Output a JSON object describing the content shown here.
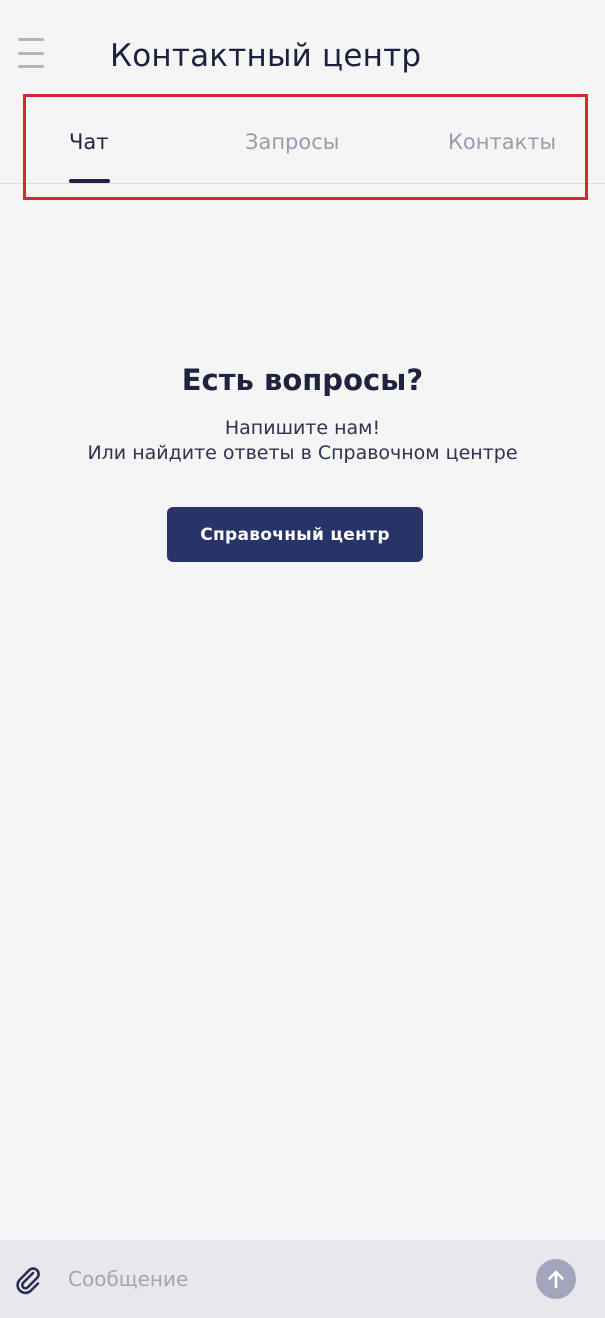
{
  "header": {
    "title": "Контактный центр",
    "menu_icon": "hamburger-menu-icon"
  },
  "tabs": [
    {
      "label": "Чат",
      "active": true
    },
    {
      "label": "Запросы",
      "active": false
    },
    {
      "label": "Контакты",
      "active": false
    }
  ],
  "empty_state": {
    "title": "Есть вопросы?",
    "line1": "Напишите нам!",
    "line2": "Или найдите ответы в Справочном центре",
    "button_label": "Справочный центр"
  },
  "composer": {
    "placeholder": "Сообщение",
    "attach_icon": "paperclip-icon",
    "send_icon": "arrow-up-icon"
  },
  "colors": {
    "accent": "#283467",
    "highlight_border": "#d6262e",
    "background": "#f5f5f6",
    "send_button": "#a4a5bd"
  }
}
